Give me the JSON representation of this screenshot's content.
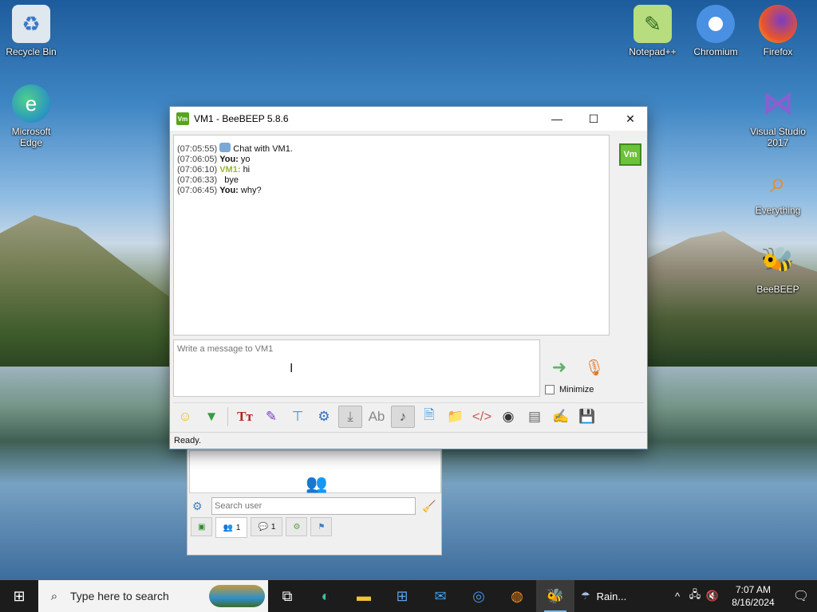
{
  "desktop": {
    "icons": [
      {
        "label": "Recycle Bin",
        "icon": "recycle-bin-icon"
      },
      {
        "label": "Microsoft Edge",
        "icon": "edge-icon"
      },
      {
        "label": "Notepad++",
        "icon": "notepadpp-icon"
      },
      {
        "label": "Chromium",
        "icon": "chromium-icon"
      },
      {
        "label": "Firefox",
        "icon": "firefox-icon"
      },
      {
        "label": "Visual Studio 2017",
        "icon": "visual-studio-icon"
      },
      {
        "label": "Everything",
        "icon": "everything-icon"
      },
      {
        "label": "BeeBEEP",
        "icon": "beebeep-icon"
      }
    ]
  },
  "chat_window": {
    "title": "VM1 - BeeBEEP 5.8.6",
    "app_badge": "Vm",
    "history": [
      {
        "time": "(07:05:55)",
        "sender": "",
        "text": "Chat with VM1."
      },
      {
        "time": "(07:06:05)",
        "sender": "You:",
        "text": "yo"
      },
      {
        "time": "(07:06:10)",
        "sender": "VM1:",
        "text": "hi"
      },
      {
        "time": "(07:06:33)",
        "sender": "",
        "text": "bye"
      },
      {
        "time": "(07:06:45)",
        "sender": "You:",
        "text": "why?"
      }
    ],
    "contact_avatar": "Vm",
    "input_placeholder": "Write a message to VM1",
    "minimize_label": "Minimize",
    "status": "Ready."
  },
  "users_window": {
    "search_placeholder": "Search user",
    "tabs": [
      {
        "count": ""
      },
      {
        "count": "1"
      },
      {
        "count": "1"
      },
      {
        "count": ""
      },
      {
        "count": ""
      }
    ]
  },
  "taskbar": {
    "search_placeholder": "Type here to search",
    "weather": "Rain...",
    "time": "7:07 AM",
    "date": "8/16/2024"
  },
  "colors": {
    "vm_green": "#6cc23a",
    "vm1_sender": "#9bb53a",
    "taskbar": "#1c1c1c",
    "active_indicator": "#76b9ed"
  }
}
